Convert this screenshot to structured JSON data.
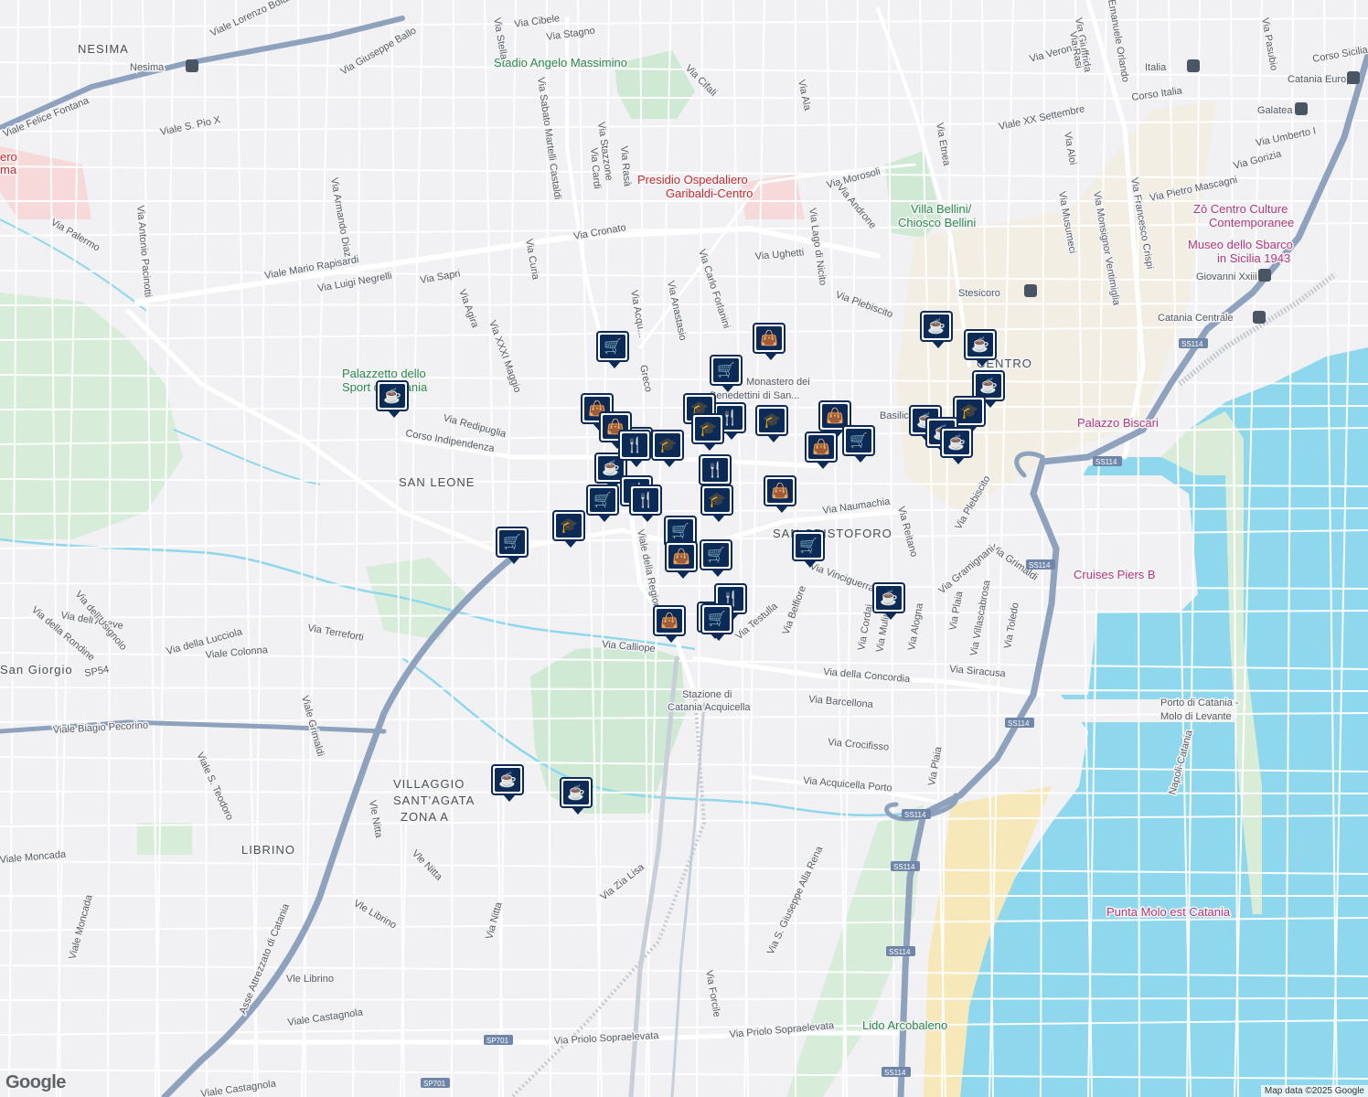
{
  "map": {
    "attribution": "Map data ©2025 Google",
    "logo": "Google",
    "colors": {
      "land": "#f1f1f4",
      "water": "#8fd7ec",
      "park": "#cfe9d4",
      "road": "#ffffff",
      "highway": "#8ea1bd",
      "pin_border": "#0b2a56",
      "beach": "#f6e8b8"
    }
  },
  "labels": {
    "areas": [
      "NESIMA",
      "SAN LEONE",
      "VILLAGGIO",
      "SANT'AGATA",
      "ZONA A",
      "LIBRINO",
      "San Giorgio",
      "SAN CRISTOFORO",
      "CENTRO"
    ],
    "pois": {
      "stadio": "Stadio Angelo Massimino",
      "palazzetto_1": "Palazzetto dello",
      "palazzetto_2": "Sport di Catania",
      "presidio_1": "Presidio Ospedaliero",
      "presidio_2": "Garibaldi-Centro",
      "villa_1": "Villa Bellini/",
      "villa_2": "Chiosco Bellini",
      "monastero_1": "Monastero dei",
      "monastero_2": "Benedettini di San...",
      "zo_1": "Zō Centro Culture",
      "zo_2": "Contemporanee",
      "museo_1": "Museo dello Sbarco",
      "museo_2": "in Sicilia 1943",
      "biscari": "Palazzo Biscari",
      "cruises": "Cruises Piers B",
      "porto_1": "Porto di Catania -",
      "porto_2": "Molo di Levante",
      "punta": "Punta Molo est Catania",
      "lido": "Lido Arcobaleno",
      "stazione_1": "Stazione di",
      "stazione_2": "Catania Acquicella",
      "basilica": "Basilica",
      "ero": "ero",
      "ma": "ma"
    },
    "metro": [
      "Nesima",
      "Italia",
      "Galatea",
      "Stesicoro",
      "Giovanni Xxiii",
      "Catania Centrale",
      "Catania Europa"
    ],
    "streets": [
      "Viale Lorenzo Bolano",
      "Via Cibele",
      "Via Stagno",
      "Via Stella",
      "Via Giuseppe Ballo",
      "Viale S. Pio X",
      "Viale Felice Fontana",
      "Via Palermo",
      "Via Armando Diaz",
      "Via Antonio Pacinotti",
      "Viale Mario Rapisardi",
      "Via Luigi Negrelli",
      "Via Sapri",
      "Via Curia",
      "Via Agira",
      "Via XXXI Maggio",
      "Via Redipuglia",
      "Corso Indipendenza",
      "Via Sabato Martelli Castaldi",
      "Via Stazzone",
      "Via Cardi",
      "Via Rasà",
      "Via Cronato",
      "Via Cifali",
      "Via Ala",
      "Via Morosoli",
      "Via Androne",
      "Via Lago di Nicito",
      "Via Ughetti",
      "Via Carlo Forlanini",
      "Via Anastasio",
      "Via Plebiscito",
      "Via Etnea",
      "Via Verona",
      "Viale XX Settembre",
      "Via Aloi",
      "Via Musumeci",
      "Via Monsignor Ventimiglia",
      "Via Francesco Crispi",
      "Corso Italia",
      "Via Umberto I",
      "Via Gorizia",
      "Via Pietro Mascagni",
      "Via Pasubio",
      "Corso Sicilia",
      "Via Giuffrida",
      "Emanuele Orlando",
      "Via Naumachia",
      "Via Reitano",
      "Via Plebiscito",
      "Via Grimaldi",
      "Via Gramignani",
      "Via Vinciguerra",
      "Via Belfiore",
      "Via della Concordia",
      "Via Testulla",
      "Viale della Regione",
      "Via Calliope",
      "Via Terreforti",
      "Via dell'Agave",
      "Via della Lucciola",
      "Viale Colonna",
      "Via dell'Usignolo",
      "Via della Rondine",
      "SP54",
      "Viale Biagio Pecorino",
      "Viale Grimaldi",
      "Viale S. Teodoro",
      "Vle Nitta",
      "Vle Nitta",
      "Viale Moncada",
      "Vle Librino",
      "Asse Attrezzato di Catania",
      "Via Nitta",
      "Viale Moncada",
      "Vle Librino",
      "Viale Castagnola",
      "Viale Castagnola",
      "Via Zia Lisa",
      "Via Forcile",
      "Via S. Giuseppe Alla Rena",
      "Via Priolo Sopraelevata",
      "Via Priolo Sopraelevata",
      "Via Barcellona",
      "Via Crocifisso",
      "Via Acquicella Porto",
      "Via Plaia",
      "Via Siracusa",
      "Via Cordai",
      "Via Mulini",
      "Via Alogna",
      "Via Plaia",
      "Via Villascabrosa",
      "Via Toledo",
      "Via Rasi",
      "Greco",
      "Via Acqu...",
      "Napoli-Catania"
    ],
    "shields": [
      "SS114",
      "SS114",
      "SS114",
      "SS114",
      "SS114",
      "SS114",
      "SS114",
      "SS114",
      "SP701",
      "SP701"
    ]
  },
  "pins": [
    {
      "icon": "cart-icon",
      "glyph": "🛒"
    },
    {
      "icon": "bag-icon",
      "glyph": "👜"
    },
    {
      "icon": "cart-icon",
      "glyph": "🛒"
    },
    {
      "icon": "cup-icon",
      "glyph": "☕"
    },
    {
      "icon": "cup-icon",
      "glyph": "☕"
    },
    {
      "icon": "cup-icon",
      "glyph": "☕"
    },
    {
      "icon": "cup-icon",
      "glyph": "☕"
    },
    {
      "icon": "grad-cap-icon",
      "glyph": "🎓"
    },
    {
      "icon": "bag-icon",
      "glyph": "👜"
    },
    {
      "icon": "fork-knife-icon",
      "glyph": "🍴"
    },
    {
      "icon": "grad-cap-icon",
      "glyph": "🎓"
    },
    {
      "icon": "grad-cap-icon",
      "glyph": "🎓"
    },
    {
      "icon": "cup-icon",
      "glyph": "☕"
    },
    {
      "icon": "fork-knife-icon",
      "glyph": "🍴"
    },
    {
      "icon": "grad-cap-icon",
      "glyph": "🎓"
    },
    {
      "icon": "bag-icon",
      "glyph": "👜"
    },
    {
      "icon": "bag-icon",
      "glyph": "👜"
    },
    {
      "icon": "cart-icon",
      "glyph": "🛒"
    },
    {
      "icon": "bag-icon",
      "glyph": "👜"
    },
    {
      "icon": "cup-icon",
      "glyph": "☕"
    },
    {
      "icon": "cup-icon",
      "glyph": "☕"
    },
    {
      "icon": "cup-icon",
      "glyph": "☕"
    },
    {
      "icon": "fork-knife-icon",
      "glyph": "🍴"
    },
    {
      "icon": "grad-cap-icon",
      "glyph": "🎓"
    },
    {
      "icon": "fork-knife-icon",
      "glyph": "🍴"
    },
    {
      "icon": "bag-icon",
      "glyph": "👜"
    },
    {
      "icon": "fork-knife-icon",
      "glyph": "🍴"
    },
    {
      "icon": "cart-icon",
      "glyph": "🛒"
    },
    {
      "icon": "fork-knife-icon",
      "glyph": "🍴"
    },
    {
      "icon": "grad-cap-icon",
      "glyph": "🎓"
    },
    {
      "icon": "cart-icon",
      "glyph": "🛒"
    },
    {
      "icon": "grad-cap-icon",
      "glyph": "🎓"
    },
    {
      "icon": "cart-icon",
      "glyph": "🛒"
    },
    {
      "icon": "cart-icon",
      "glyph": "🛒"
    },
    {
      "icon": "bag-icon",
      "glyph": "👜"
    },
    {
      "icon": "cart-icon",
      "glyph": "🛒"
    },
    {
      "icon": "cart-icon",
      "glyph": "🛒"
    },
    {
      "icon": "fork-knife-icon",
      "glyph": "🍴"
    },
    {
      "icon": "cup-icon",
      "glyph": "☕"
    },
    {
      "icon": "bag-icon",
      "glyph": "👜"
    },
    {
      "icon": "cart-icon",
      "glyph": "🛒"
    },
    {
      "icon": "cup-icon",
      "glyph": "☕"
    },
    {
      "icon": "cup-icon",
      "glyph": "☕"
    }
  ]
}
